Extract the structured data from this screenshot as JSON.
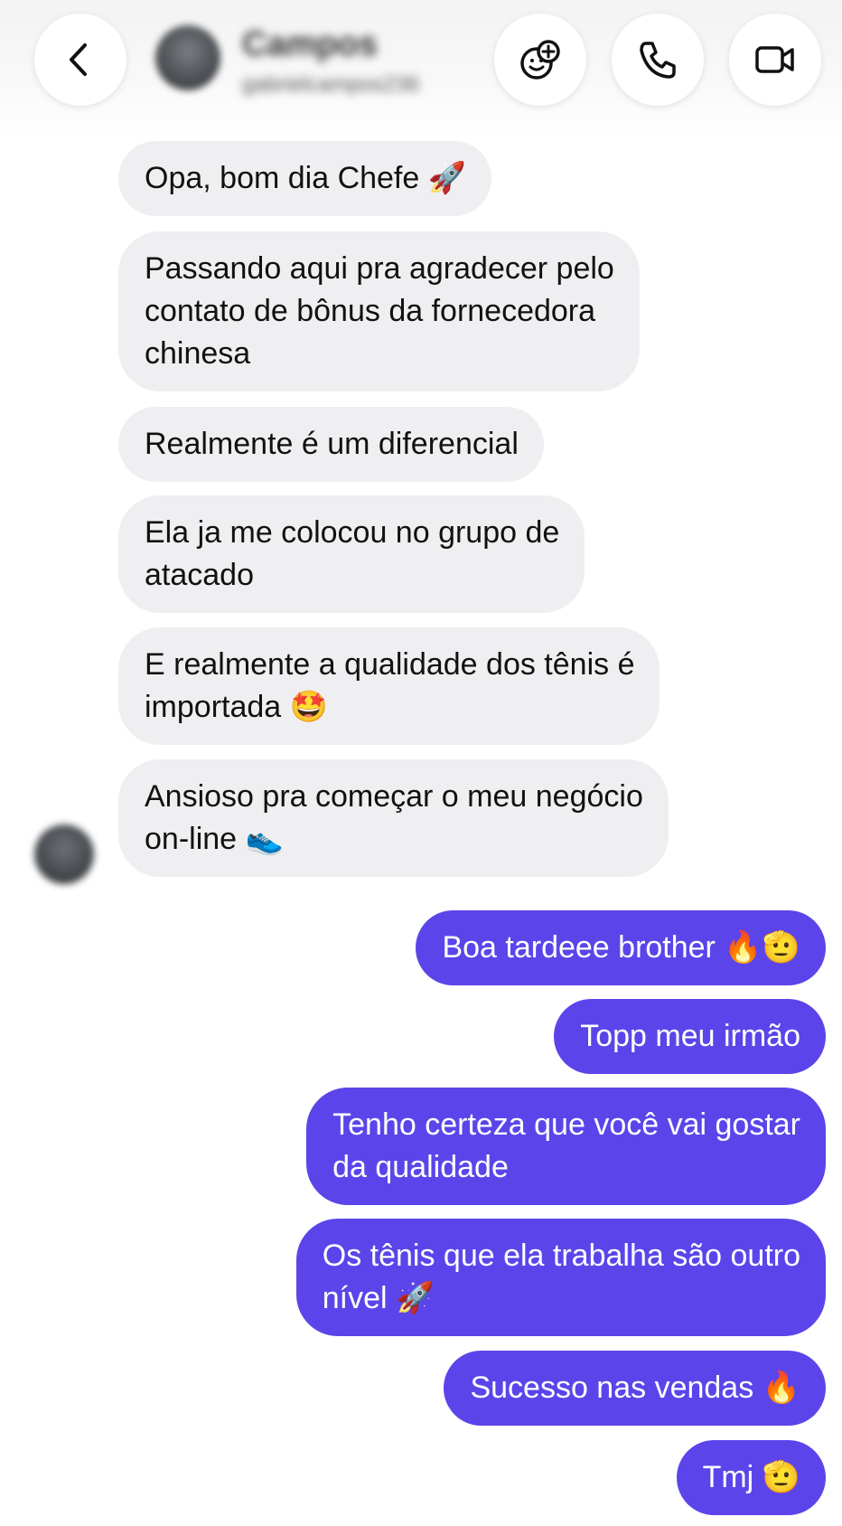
{
  "header": {
    "contact_name": "Campos",
    "contact_handle": "gabrielcampos236",
    "back_icon": "chevron-left-icon",
    "effects_icon": "smiley-plus-icon",
    "call_icon": "phone-icon",
    "video_icon": "video-camera-icon"
  },
  "messages": {
    "incoming": [
      "Opa, bom dia Chefe 🚀",
      "Passando aqui pra agradecer pelo\ncontato de bônus da fornecedora\nchinesa",
      "Realmente é um diferencial",
      "Ela ja me colocou no grupo de\natacado",
      "E realmente a qualidade dos tênis é\nimportada 🤩",
      "Ansioso pra começar o meu negócio\non-line 👟"
    ],
    "outgoing": [
      "Boa tardeee brother   🔥🫡",
      "Topp meu irmão",
      "Tenho certeza que você vai gostar\nda qualidade",
      "Os tênis que ela trabalha são outro\nnível 🚀",
      "Sucesso nas vendas 🔥",
      "Tmj 🫡"
    ]
  },
  "colors": {
    "incoming_bubble": "#efeff2",
    "outgoing_bubble": "#5b45ea",
    "outgoing_text": "#ffffff",
    "incoming_text": "#111111"
  }
}
